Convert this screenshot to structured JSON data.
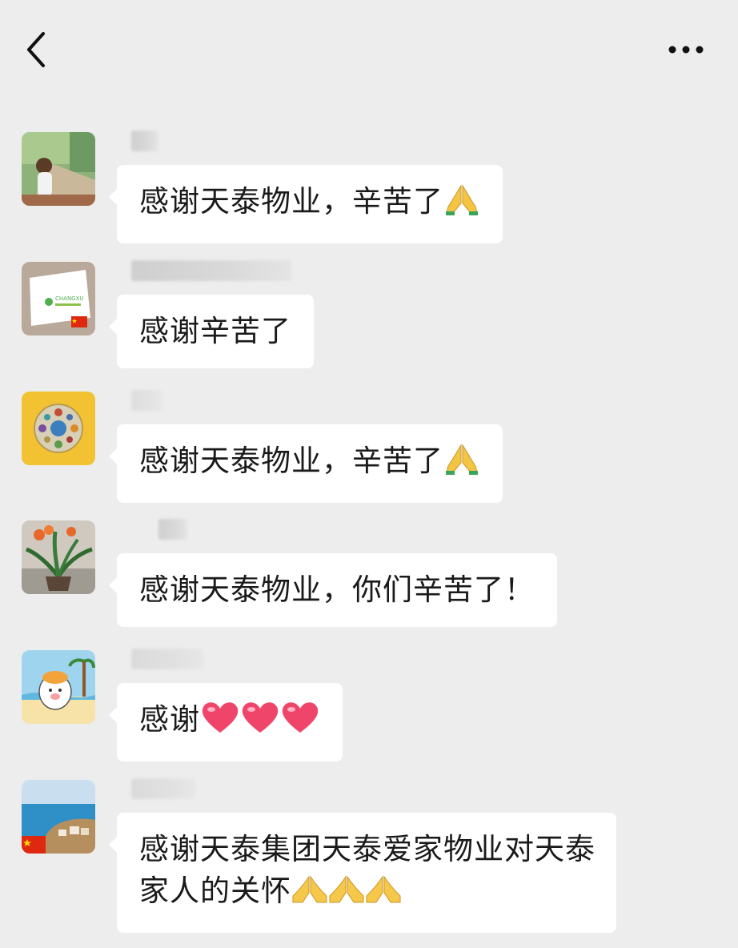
{
  "header": {
    "title": "",
    "back_icon": "chevron-left-icon",
    "more_icon": "more-dots-icon"
  },
  "messages": [
    {
      "text": "感谢天泰物业，辛苦了",
      "emoji": [
        "folded-hands"
      ]
    },
    {
      "text": "感谢辛苦了",
      "emoji": []
    },
    {
      "text": "感谢天泰物业，辛苦了",
      "emoji": [
        "folded-hands"
      ]
    },
    {
      "text": "感谢天泰物业，你们辛苦了！",
      "emoji": []
    },
    {
      "text": "感谢",
      "emoji": [
        "heart",
        "heart",
        "heart"
      ]
    },
    {
      "line1": "感谢天泰集团天泰爱家物业对天泰",
      "line2": "家人的关怀",
      "emoji": [
        "folded-hands",
        "folded-hands",
        "folded-hands"
      ]
    }
  ],
  "avatars": {
    "a2_logo_text": "CHANGXU"
  },
  "colors": {
    "background": "#ededed",
    "bubble": "#ffffff",
    "text": "#1a1a1a",
    "heart": "#f0456a",
    "hands": "#f4c542"
  }
}
